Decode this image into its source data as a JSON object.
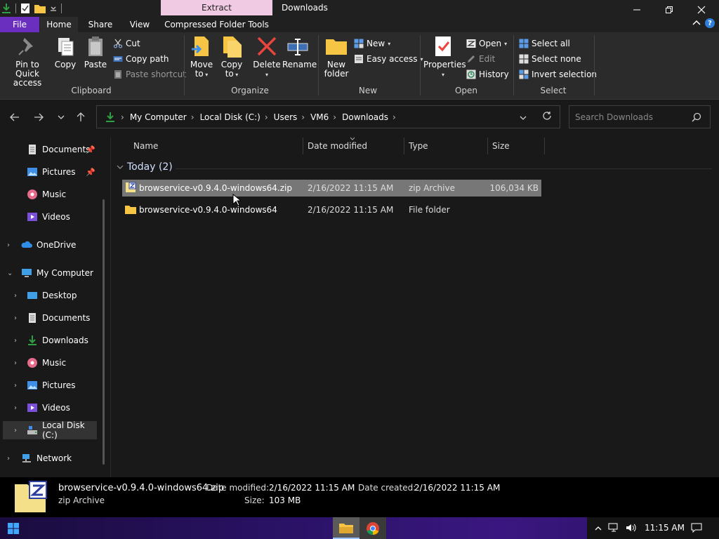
{
  "titlebar": {
    "contextual_tab": "Extract",
    "title": "Downloads"
  },
  "ribbon_tabs": {
    "file": "File",
    "home": "Home",
    "share": "Share",
    "view": "View",
    "compressed": "Compressed Folder Tools"
  },
  "ribbon": {
    "clipboard": {
      "label": "Clipboard",
      "pin": "Pin to Quick access",
      "copy": "Copy",
      "paste": "Paste",
      "cut": "Cut",
      "copy_path": "Copy path",
      "paste_shortcut": "Paste shortcut"
    },
    "organize": {
      "label": "Organize",
      "move_to": "Move to",
      "copy_to": "Copy to",
      "delete": "Delete",
      "rename": "Rename"
    },
    "new": {
      "label": "New",
      "new_folder": "New folder",
      "new_item": "New",
      "easy_access": "Easy access"
    },
    "open": {
      "label": "Open",
      "properties": "Properties",
      "open": "Open",
      "edit": "Edit",
      "history": "History"
    },
    "select": {
      "label": "Select",
      "select_all": "Select all",
      "select_none": "Select none",
      "invert": "Invert selection"
    }
  },
  "address": {
    "crumbs": [
      "My Computer",
      "Local Disk (C:)",
      "Users",
      "VM6",
      "Downloads"
    ],
    "search_placeholder": "Search Downloads"
  },
  "nav": {
    "documents_quick": "Documents",
    "pictures_quick": "Pictures",
    "music_quick": "Music",
    "videos_quick": "Videos",
    "onedrive": "OneDrive",
    "my_computer": "My Computer",
    "desktop": "Desktop",
    "documents": "Documents",
    "downloads": "Downloads",
    "music": "Music",
    "pictures": "Pictures",
    "videos": "Videos",
    "local_disk": "Local Disk (C:)",
    "network": "Network"
  },
  "columns": {
    "name": "Name",
    "date": "Date modified",
    "type": "Type",
    "size": "Size"
  },
  "group": "Today (2)",
  "files": [
    {
      "name": "browservice-v0.9.4.0-windows64.zip",
      "date": "2/16/2022 11:15 AM",
      "type": "zip Archive",
      "size": "106,034 KB"
    },
    {
      "name": "browservice-v0.9.4.0-windows64",
      "date": "2/16/2022 11:15 AM",
      "type": "File folder",
      "size": ""
    }
  ],
  "details": {
    "name": "browservice-v0.9.4.0-windows64.zip",
    "type": "zip Archive",
    "date_modified_label": "Date modified:",
    "date_modified": "2/16/2022 11:15 AM",
    "date_created_label": "Date created:",
    "date_created": "2/16/2022 11:15 AM",
    "size_label": "Size:",
    "size": "103 MB"
  },
  "taskbar": {
    "clock": "11:15 AM"
  }
}
